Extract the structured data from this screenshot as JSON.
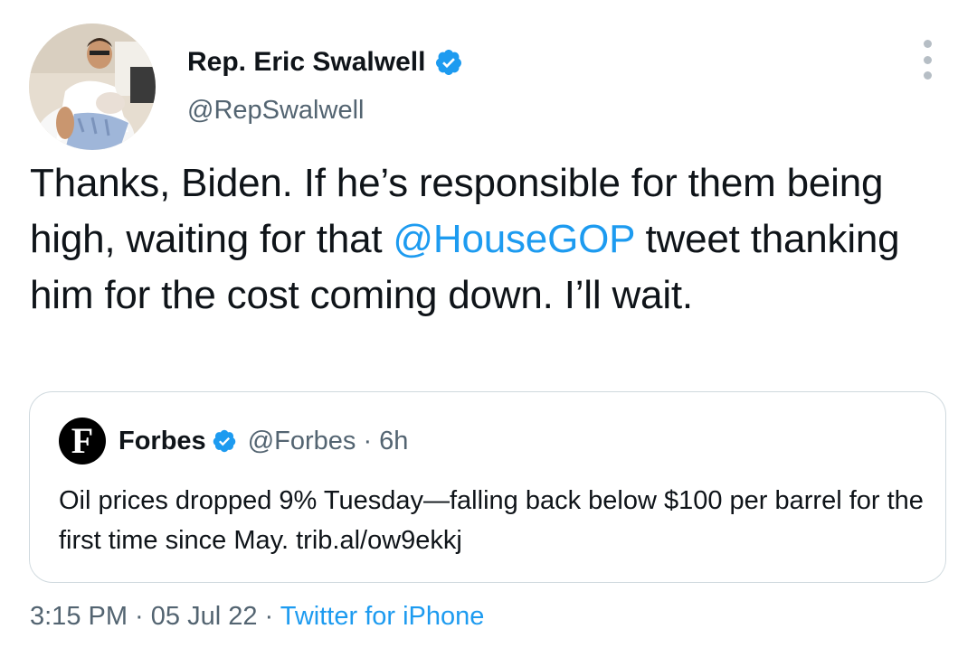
{
  "author": {
    "display_name": "Rep. Eric Swalwell",
    "handle": "@RepSwalwell",
    "avatar_icon": "profile-photo"
  },
  "tweet": {
    "text_before": "Thanks, Biden. If he’s responsible for them being high, waiting for that ",
    "mention": "@HouseGOP",
    "text_after": " tweet thanking him for the cost coming down. I’ll wait."
  },
  "quoted": {
    "logo_letter": "F",
    "name": "Forbes",
    "handle_time": "@Forbes · 6h",
    "text": "Oil prices dropped 9% Tuesday—falling back below $100 per barrel for the first time since May. trib.al/ow9ekkj"
  },
  "meta": {
    "time": "3:15 PM",
    "separator1": " · ",
    "date": "05 Jul 22",
    "separator2": " · ",
    "source": "Twitter for iPhone"
  },
  "colors": {
    "link": "#1d9bf0",
    "secondary_text": "#536471",
    "border": "#cfd9de"
  }
}
